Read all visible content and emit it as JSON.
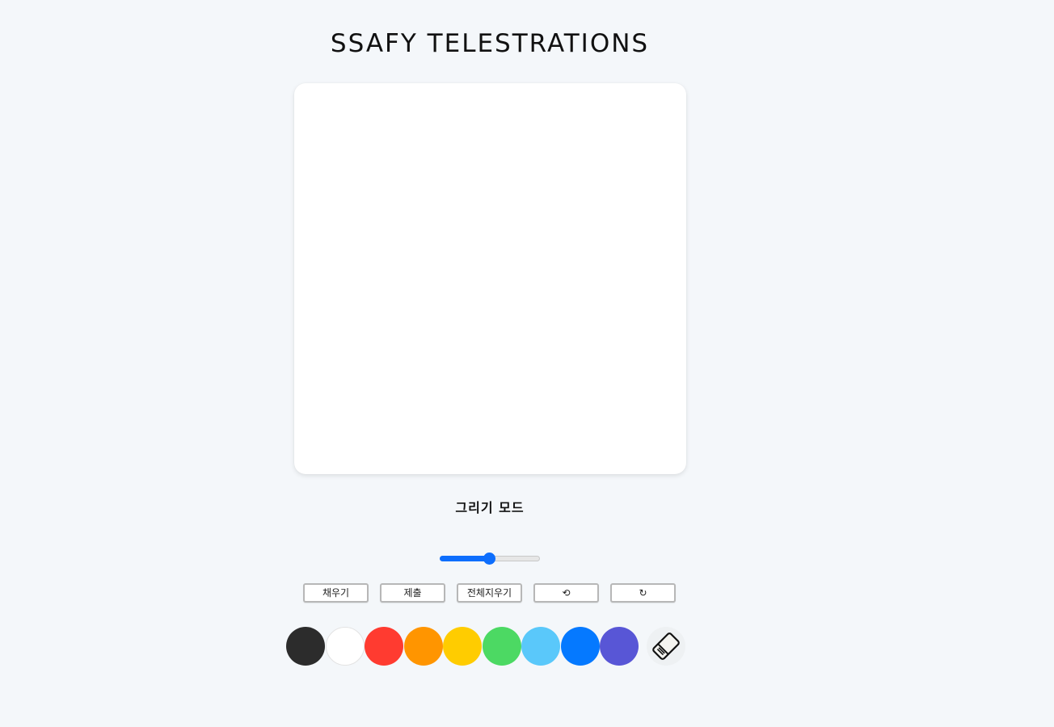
{
  "header": {
    "title": "SSAFY TELESTRATIONS"
  },
  "mode": {
    "label": "그리기 모드"
  },
  "brush_size": {
    "value_fraction": 0.5
  },
  "toolbar": {
    "buttons": [
      {
        "label": "채우기",
        "name": "fill-button"
      },
      {
        "label": "제출",
        "name": "submit-button"
      },
      {
        "label": "전체지우기",
        "name": "clear-all-button"
      },
      {
        "label": "⟲",
        "name": "undo-button"
      },
      {
        "label": "↻",
        "name": "redo-button"
      }
    ]
  },
  "palette": {
    "colors": [
      {
        "name": "black",
        "hex": "#2c2c2c"
      },
      {
        "name": "white",
        "hex": "#ffffff"
      },
      {
        "name": "red",
        "hex": "#ff3b30"
      },
      {
        "name": "orange",
        "hex": "#ff9500"
      },
      {
        "name": "yellow",
        "hex": "#ffcc00"
      },
      {
        "name": "green",
        "hex": "#4cd963"
      },
      {
        "name": "sky-blue",
        "hex": "#5ac8fa"
      },
      {
        "name": "blue",
        "hex": "#0579ff"
      },
      {
        "name": "purple",
        "hex": "#5856d6"
      }
    ],
    "eraser_icon": "eraser-icon"
  },
  "accent_color": "#0d6efd"
}
